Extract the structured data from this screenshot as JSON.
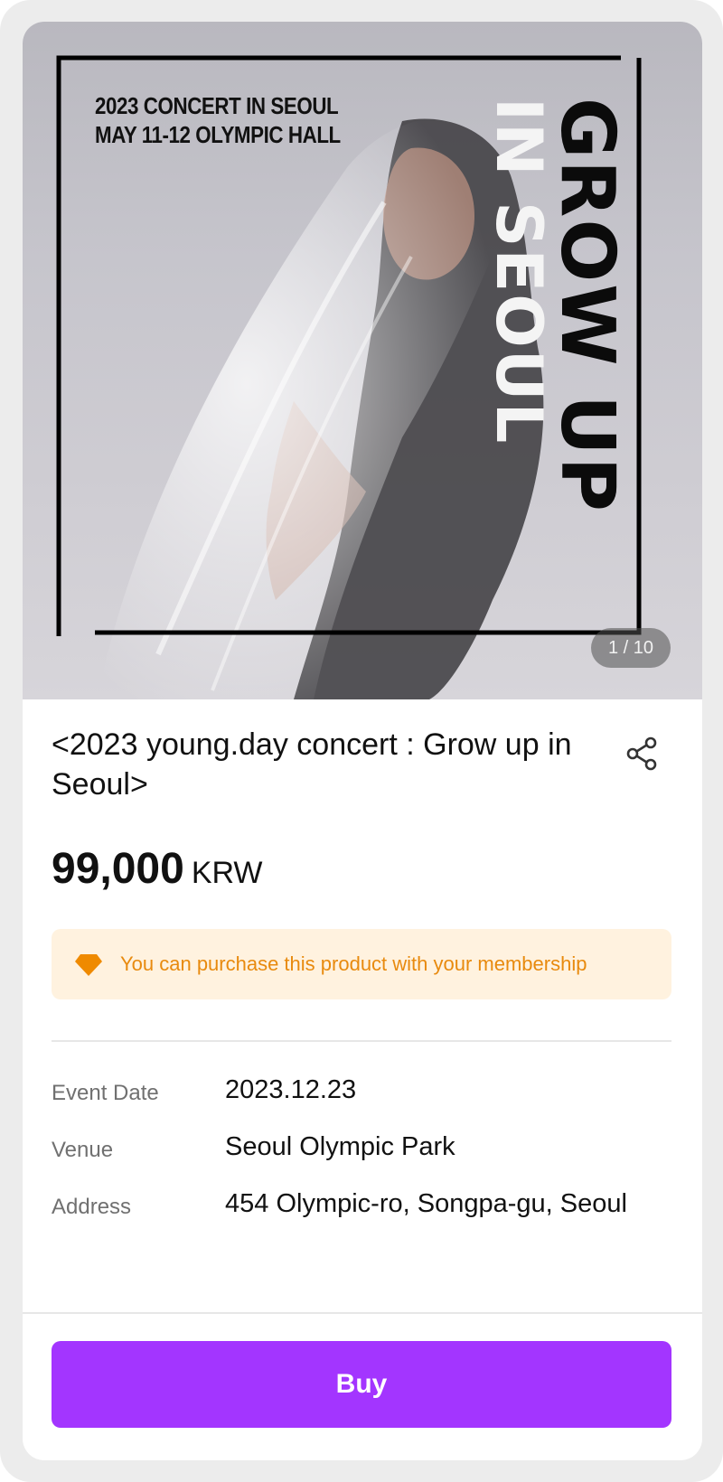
{
  "poster": {
    "line1": "2023 CONCERT IN SEOUL",
    "line2": "MAY 11-12 OLYMPIC HALL",
    "big_text_1": "GROW UP",
    "big_text_2": "IN SEOUL",
    "pager": "1 / 10"
  },
  "product": {
    "title": "<2023 young.day concert : Grow up in Seoul>",
    "price": "99,000",
    "currency": "KRW",
    "membership_notice": "You can purchase this product with your membership"
  },
  "details": [
    {
      "label": "Event Date",
      "value": "2023.12.23"
    },
    {
      "label": "Venue",
      "value": "Seoul Olympic Park"
    },
    {
      "label": "Address",
      "value": "454 Olympic-ro, Songpa-gu, Seoul"
    }
  ],
  "actions": {
    "buy_label": "Buy",
    "share_icon": "share-icon"
  },
  "colors": {
    "accent": "#a335ff",
    "notice_bg": "#fff2df",
    "notice_text": "#e88a0e"
  }
}
